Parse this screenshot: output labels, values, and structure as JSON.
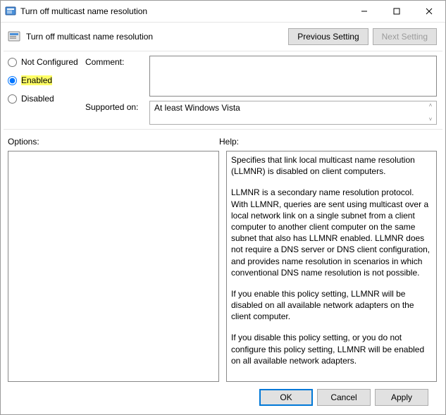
{
  "window": {
    "title": "Turn off multicast name resolution"
  },
  "header": {
    "title": "Turn off multicast name resolution",
    "prev": "Previous Setting",
    "next": "Next Setting"
  },
  "state": {
    "not_configured": "Not Configured",
    "enabled": "Enabled",
    "disabled": "Disabled",
    "selected": "enabled"
  },
  "fields": {
    "comment_label": "Comment:",
    "comment_value": "",
    "supported_label": "Supported on:",
    "supported_value": "At least Windows Vista"
  },
  "labels": {
    "options": "Options:",
    "help": "Help:"
  },
  "help": {
    "p1": "Specifies that link local multicast name resolution (LLMNR) is disabled on client computers.",
    "p2": "LLMNR is a secondary name resolution protocol. With LLMNR, queries are sent using multicast over a local network link on a single subnet from a client computer to another client computer on the same subnet that also has LLMNR enabled. LLMNR does not require a DNS server or DNS client configuration, and provides name resolution in scenarios in which conventional DNS name resolution is not possible.",
    "p3": "If you enable this policy setting, LLMNR will be disabled on all available network adapters on the client computer.",
    "p4": "If you disable this policy setting, or you do not configure this policy setting, LLMNR will be enabled on all available network adapters."
  },
  "footer": {
    "ok": "OK",
    "cancel": "Cancel",
    "apply": "Apply"
  }
}
